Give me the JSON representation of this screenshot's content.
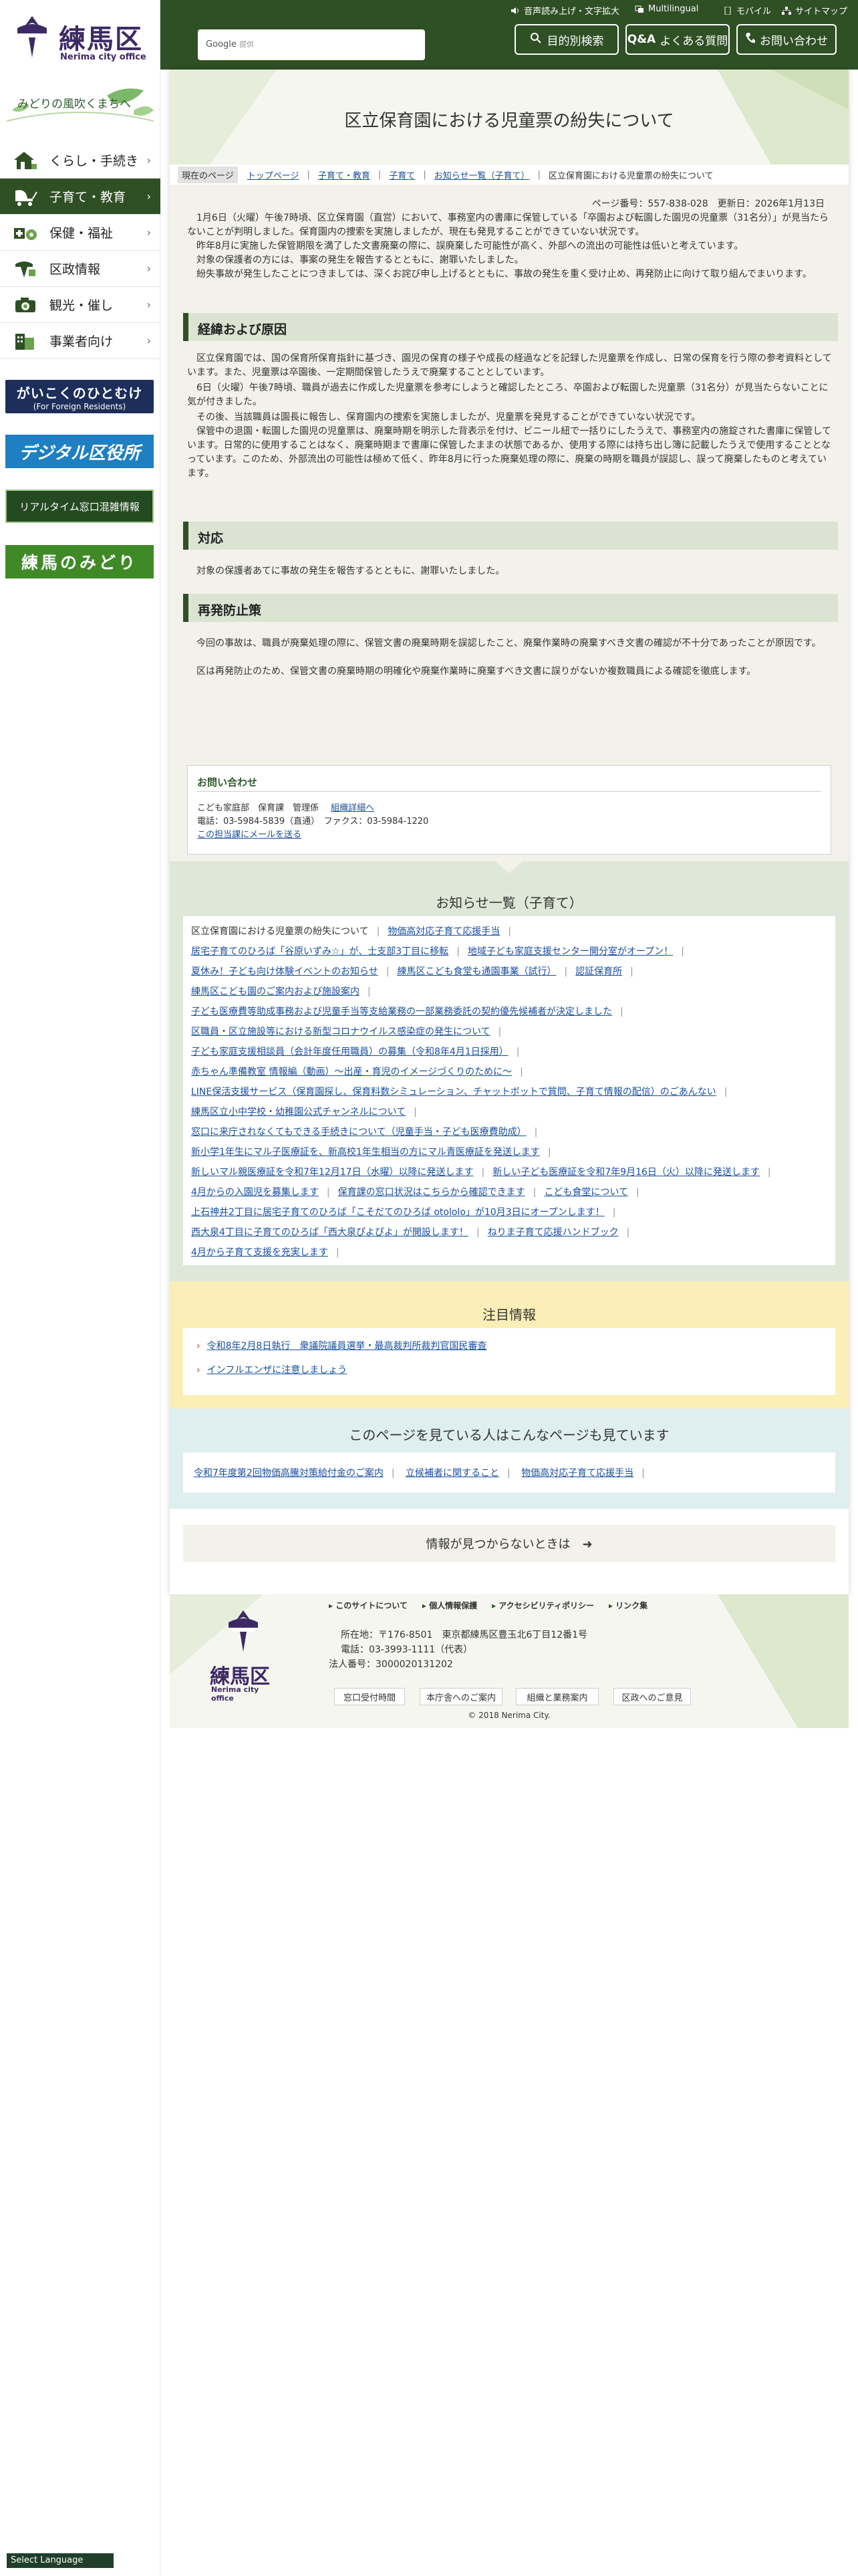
{
  "site": {
    "name_jp": "練馬区",
    "name_en": "Nerima city office",
    "slogan": "みどりの風吹くまちへ"
  },
  "utility": {
    "audio": "音声読み上げ・文字拡大",
    "multilingual": "Multilingual",
    "mobile": "モバイル",
    "sitemap": "サイトマップ"
  },
  "header": {
    "search_label": "Google",
    "search_sub": "提供",
    "btn_purpose": "目的別検索",
    "btn_faq": "よくある質問",
    "btn_contact": "お問い合わせ"
  },
  "nav": [
    {
      "label": "くらし・手続き",
      "icon": "house-icon"
    },
    {
      "label": "子育て・教育",
      "icon": "stroller-icon"
    },
    {
      "label": "保健・福祉",
      "icon": "health-icon"
    },
    {
      "label": "区政情報",
      "icon": "city-icon"
    },
    {
      "label": "観光・催し",
      "icon": "camera-icon"
    },
    {
      "label": "事業者向け",
      "icon": "building-icon"
    }
  ],
  "banners": {
    "b1_main": "がいこくのひとむけ",
    "b1_sub": "(For Foreign Residents)",
    "b2": "デジタル区役所",
    "b3": "リアルタイム窓口混雑情報",
    "b4": "練馬のみどり"
  },
  "page": {
    "title": "区立保育園における児童票の紛失について",
    "breadcrumb_here": "現在のページ",
    "breadcrumb": [
      "トップページ",
      "子育て・教育",
      "子育て",
      "お知らせ一覧（子育て）",
      "区立保育園における児童票の紛失について"
    ],
    "page_id": "ページ番号：557-838-028　更新日：2026年1月13日",
    "intro": [
      "　1月6日（火曜）午後7時頃、区立保育園（直営）において、事務室内の書庫に保管している「卒園および転園した園児の児童票（31名分）」が見当たらないことが判明しました。保育園内の捜索を実施しましたが、現在も発見することができていない状況です。",
      "　昨年8月に実施した保管期限を満了した文書廃棄の際に、誤廃棄した可能性が高く、外部への流出の可能性は低いと考えています。",
      "　対象の保護者の方には、事案の発生を報告するとともに、謝罪いたしました。",
      "　紛失事故が発生したことにつきましては、深くお詫び申し上げるとともに、事故の発生を重く受け止め、再発防止に向けて取り組んでまいります。"
    ],
    "sec1_title": "経緯および原因",
    "sec1_paras": [
      "　区立保育園では、国の保育所保育指針に基づき、園児の保育の様子や成長の経過などを記録した児童票を作成し、日常の保育を行う際の参考資料としています。また、児童票は卒園後、一定期間保管したうえで廃棄することとしています。",
      "　6日（火曜）午後7時頃、職員が過去に作成した児童票を参考にしようと確認したところ、卒園および転園した児童票（31名分）が見当たらないことに気が付きました。",
      "　その後、当該職員は園長に報告し、保育園内の捜索を実施しましたが、児童票を発見することができていない状況です。",
      "　保管中の退園・転園した園児の児童票は、廃棄時期を明示した背表示を付け、ビニール紐で一括りにしたうえで、事務室内の施錠された書庫に保管しています。日常的に使用することはなく、廃棄時期まで書庫に保管したままの状態であるか、使用する際には持ち出し簿に記載したうえで使用することとなっています。このため、外部流出の可能性は極めて低く、昨年8月に行った廃棄処理の際に、廃棄の時期を職員が誤認し、誤って廃棄したものと考えています。"
    ],
    "sec2_title": "対応",
    "sec2_para": "　対象の保護者あてに事故の発生を報告するとともに、謝罪いたしました。",
    "sec3_title": "再発防止策",
    "sec3_paras": [
      "　今回の事故は、職員が廃棄処理の際に、保管文書の廃棄時期を誤認したこと、廃棄作業時の廃棄すべき文書の確認が不十分であったことが原因です。",
      "　区は再発防止のため、保管文書の廃棄時期の明確化や廃棄作業時に廃棄すべき文書に誤りがないか複数職員による確認を徹底します。"
    ]
  },
  "contact": {
    "heading": "お問い合わせ",
    "dept": "こども家庭部　保育課　管理係",
    "detail_link": "組織詳細へ",
    "phone": "電話：03-5984-5839（直通）　ファクス：03-5984-1220",
    "mail_link": "この担当課にメールを送る"
  },
  "news": {
    "heading": "お知らせ一覧（子育て）",
    "lines": [
      [
        "区立保育園における児童票の紛失について",
        "物価高対応子育て応援手当"
      ],
      [
        "居宅子育てのひろば「谷原いずみ☆」が、士支部3丁目に移転",
        "地域子ども家庭支援センター開分室がオープン！"
      ],
      [
        "夏休み！子ども向け体験イベントのお知らせ",
        "練馬区こども食堂も通園事業（試行）",
        "認証保育所"
      ],
      [
        "練馬区こども園のご案内および施設案内"
      ],
      [
        "子ども医療費等助成事務および児童手当等支給業務の一部業務委託の契約優先候補者が決定しました"
      ],
      [
        "区職員・区立施設等における新型コロナウイルス感染症の発生について"
      ],
      [
        "子ども家庭支援相談員（会計年度任用職員）の募集（令和8年4月1日採用）"
      ],
      [
        "赤ちゃん準備教室 情報編（動画）～出産・育児のイメージづくりのために～"
      ],
      [
        "LINE保活支援サービス（保育園探し、保育料数シミュレーション、チャットボットで質問、子育て情報の配信）のごあんない"
      ],
      [
        "練馬区立小中学校・幼稚園公式チャンネルについて"
      ],
      [
        "窓口に来庁されなくてもできる手続きについて（児童手当・子ども医療費助成）"
      ],
      [
        "新小学1年生にマル子医療証を、新高校1年生相当の方にマル青医療証を発送します"
      ],
      [
        "新しいマル親医療証を令和7年12月17日（水曜）以降に発送します",
        "新しい子ども医療証を令和7年9月16日（火）以降に発送します"
      ],
      [
        "4月からの入園児を募集します",
        "保育課の窓口状況はこちらから確認できます",
        "こども食堂について"
      ],
      [
        "上石神井2丁目に居宅子育てのひろば「こそだてのひろば otololo」が10月3日にオープンします！"
      ],
      [
        "西大泉4丁目に子育てのひろば「西大泉ぴよぴよ」が開設します！",
        "ねりま子育て応援ハンドブック"
      ],
      [
        "4月から子育て支援を充実します"
      ]
    ]
  },
  "attention": {
    "heading": "注目情報",
    "items": [
      "令和8年2月8日執行　衆議院議員選挙・最高裁判所裁判官国民審査",
      "インフルエンザに注意しましょう"
    ]
  },
  "viewed": {
    "heading": "このページを見ている人はこんなページも見ています",
    "items": [
      "令和7年度第2回物価高騰対策給付金のご案内",
      "立候補者に関すること",
      "物価高対応子育て応援手当"
    ]
  },
  "notfound": "情報が見つからないときは　➜",
  "footer": {
    "links": [
      "このサイトについて",
      "個人情報保護",
      "アクセシビリティポリシー",
      "リンク集"
    ],
    "address": "所在地：〒176-8501　東京都練馬区豊玉北6丁目12番1号",
    "phone": "電話：03-3993-1111（代表）",
    "corp": "法人番号：3000020131202",
    "btns": [
      "窓口受付時間",
      "本庁舎へのご案内",
      "組織と業務案内",
      "区政へのご意見"
    ],
    "copyright": "© 2018 Nerima City."
  },
  "select_language": "Select Language",
  "colors": {
    "primary": "#2f4f25",
    "brand_purple": "#3d2a64",
    "link": "#1a4fa0"
  }
}
